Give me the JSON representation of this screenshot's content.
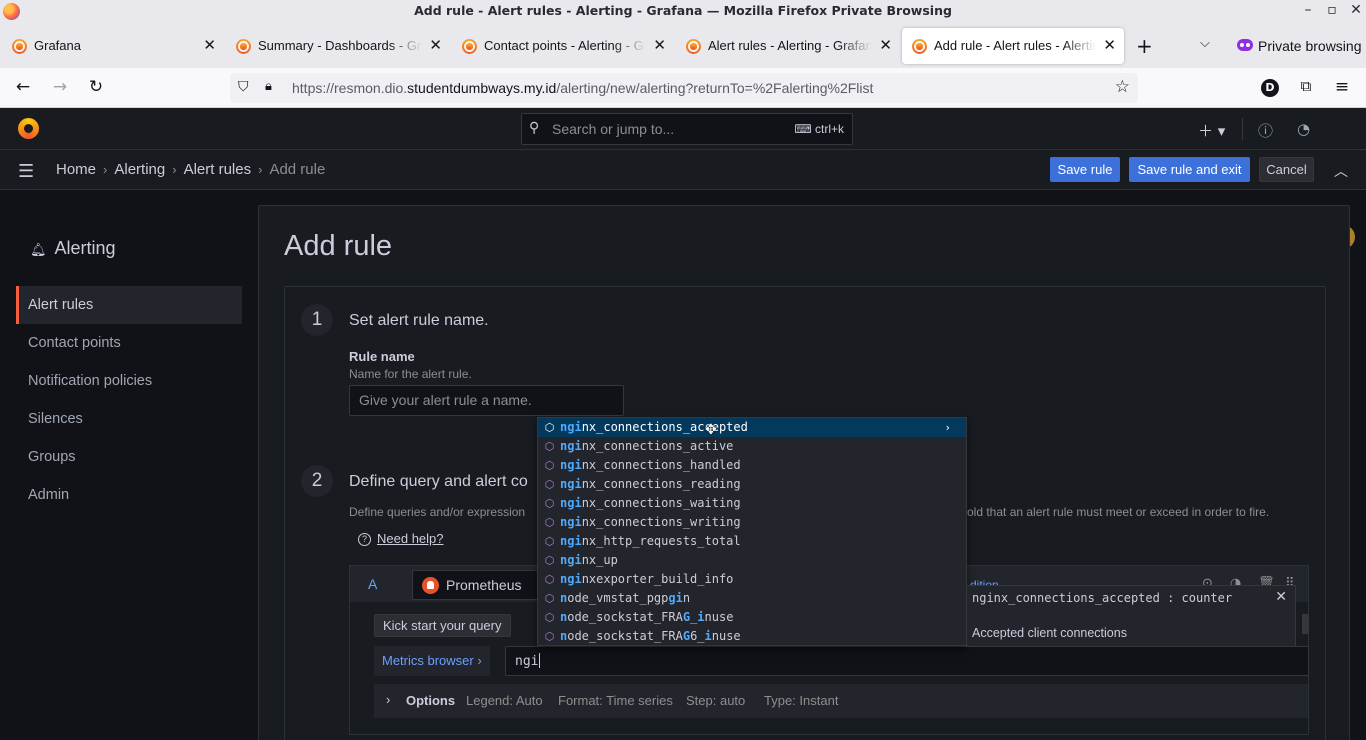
{
  "window": {
    "title": "Add rule - Alert rules - Alerting - Grafana — Mozilla Firefox Private Browsing"
  },
  "tabs": [
    {
      "label": "Grafana",
      "active": false
    },
    {
      "label": "Summary - Dashboards - Grafana",
      "active": false
    },
    {
      "label": "Contact points - Alerting - Grafana",
      "active": false
    },
    {
      "label": "Alert rules - Alerting - Grafana",
      "active": false
    },
    {
      "label": "Add rule - Alert rules - Alerting - Grafana",
      "active": true
    }
  ],
  "private_browsing_label": "Private browsing",
  "url": {
    "prefix": "https://resmon.dio.",
    "domain": "studentdumbways.my.id",
    "path": "/alerting/new/alerting?returnTo=%2Falerting%2Flist"
  },
  "profile_initial": "D",
  "grafana": {
    "search_placeholder": "Search or jump to...",
    "search_shortcut": "ctrl+k",
    "breadcrumbs": [
      "Home",
      "Alerting",
      "Alert rules",
      "Add rule"
    ],
    "buttons": {
      "save": "Save rule",
      "save_exit": "Save rule and exit",
      "cancel": "Cancel"
    }
  },
  "sidebar": {
    "title": "Alerting",
    "items": [
      {
        "label": "Alert rules",
        "active": true
      },
      {
        "label": "Contact points",
        "active": false
      },
      {
        "label": "Notification policies",
        "active": false
      },
      {
        "label": "Silences",
        "active": false
      },
      {
        "label": "Groups",
        "active": false
      },
      {
        "label": "Admin",
        "active": false
      }
    ]
  },
  "page": {
    "title": "Add rule",
    "step1": {
      "number": "1",
      "title": "Set alert rule name.",
      "field_label": "Rule name",
      "field_hint": "Name for the alert rule.",
      "placeholder": "Give your alert rule a name."
    },
    "step2": {
      "number": "2",
      "title": "Define query and alert co",
      "description_left": "Define queries and/or expression",
      "description_right": "old that an alert rule must meet or exceed in order to fire.",
      "help_link": "Need help?"
    },
    "query": {
      "ref_id": "A",
      "datasource": "Prometheus",
      "kick_start": "Kick start your query",
      "metrics_browser": "Metrics browser",
      "query_text": "ngi",
      "header_right_partial": "dition",
      "options": {
        "title": "Options",
        "legend": "Legend: Auto",
        "format": "Format: Time series",
        "step": "Step: auto",
        "type": "Type: Instant"
      }
    }
  },
  "autocomplete": {
    "items": [
      {
        "match": "ngi",
        "rest": "nx_connections_accepted",
        "selected": true
      },
      {
        "match": "ngi",
        "rest": "nx_connections_active",
        "selected": false
      },
      {
        "match": "ngi",
        "rest": "nx_connections_handled",
        "selected": false
      },
      {
        "match": "ngi",
        "rest": "nx_connections_reading",
        "selected": false
      },
      {
        "match": "ngi",
        "rest": "nx_connections_waiting",
        "selected": false
      },
      {
        "match": "ngi",
        "rest": "nx_connections_writing",
        "selected": false
      },
      {
        "match": "ngi",
        "rest": "nx_http_requests_total",
        "selected": false
      },
      {
        "match": "ngi",
        "rest": "nx_up",
        "selected": false
      },
      {
        "match": "ngi",
        "rest": "nxexporter_build_info",
        "selected": false
      }
    ],
    "fuzzy_items": [
      [
        "n",
        "ode_vmstat_pgp",
        "gi",
        "n",
        ""
      ],
      [
        "n",
        "ode_sockstat_FRA",
        "G",
        "_",
        "i",
        "nuse"
      ],
      [
        "n",
        "ode_sockstat_FRA",
        "G",
        "6_",
        "i",
        "nuse"
      ]
    ],
    "detail": {
      "title": "nginx_connections_accepted : counter",
      "doc": "Accepted client connections"
    }
  },
  "icons": {
    "firefox": "firefox-logo-icon",
    "grafana": "grafana-logo-icon",
    "metric": "cube-icon"
  }
}
